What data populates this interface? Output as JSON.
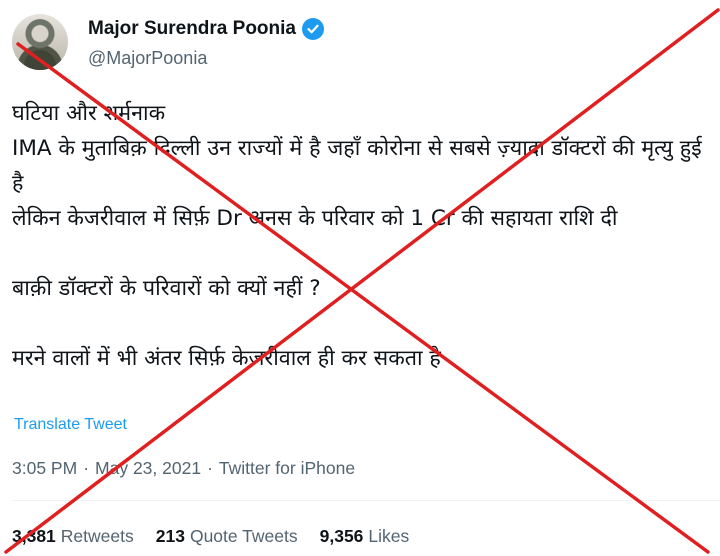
{
  "author": {
    "name": "Major Surendra Poonia",
    "handle": "@MajorPoonia",
    "verified": true,
    "avatar_icon": "user-photo",
    "verified_icon": "verified-badge-icon"
  },
  "tweet": {
    "text": "घटिया और शर्मनाक\nIMA के मुताबिक़ दिल्ली उन राज्यों में है जहाँ कोरोना से सबसे ज़्यादा डॉक्टरों की मृत्यु हुई है\nलेकिन केजरीवाल में सिर्फ़ Dr अनस के परिवार को 1 Cr की सहायता राशि दी\n\nबाक़ी डॉक्टरों के परिवारों को क्यों नहीं ?\n\nमरने वालों में भी अंतर सिर्फ़ केजरीवाल ही कर सकता है",
    "translate_label": "Translate Tweet",
    "time": "3:05 PM",
    "date": "May 23, 2021",
    "source": "Twitter for iPhone",
    "separator": "·"
  },
  "stats": {
    "retweets_count": "3,381",
    "retweets_label": "Retweets",
    "quotes_count": "213",
    "quotes_label": "Quote Tweets",
    "likes_count": "9,356",
    "likes_label": "Likes"
  },
  "overlay": {
    "type": "red-cross",
    "color": "#e02020"
  },
  "colors": {
    "text": "#0f1419",
    "secondary": "#536471",
    "link": "#1d9bf0"
  }
}
